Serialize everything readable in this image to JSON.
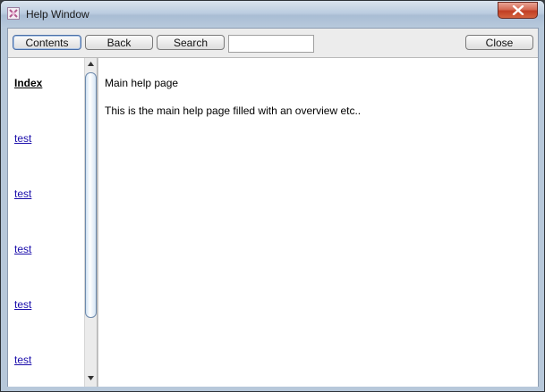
{
  "window": {
    "title": "Help Window",
    "icon": "help-app-icon",
    "close_icon": "close-icon"
  },
  "toolbar": {
    "contents_label": "Contents",
    "back_label": "Back",
    "search_label": "Search",
    "search_value": "",
    "close_label": "Close"
  },
  "nav": {
    "heading": "Index",
    "links": [
      "test",
      "test",
      "test",
      "test",
      "test"
    ]
  },
  "main": {
    "title": "Main help page",
    "body": "This is the main help page filled with an overview etc.."
  },
  "colors": {
    "link": "#1a0dab",
    "close_button": "#c13f24",
    "window_frame": "#b3c6da"
  }
}
